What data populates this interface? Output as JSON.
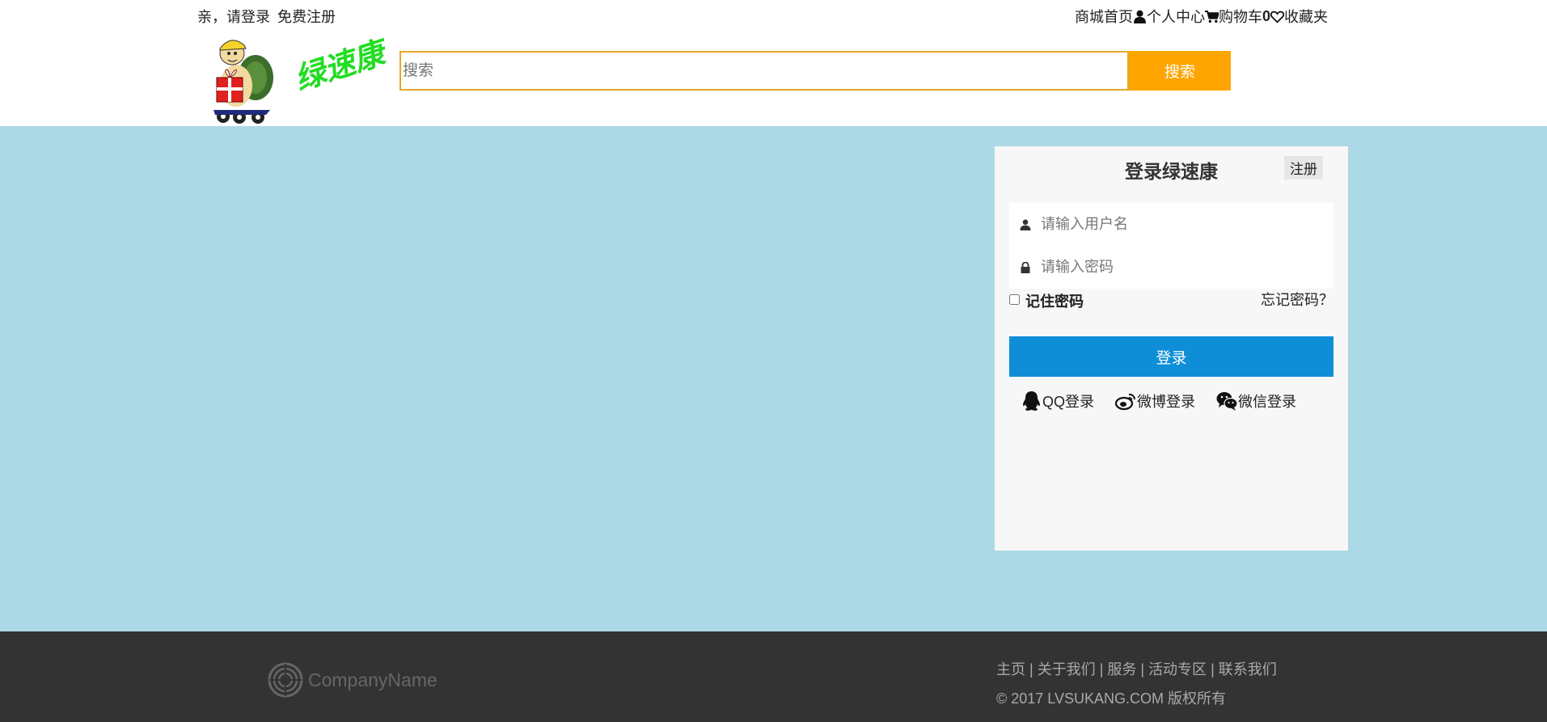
{
  "topbar": {
    "greeting": "亲，请登录",
    "register": "免费注册",
    "home": "商城首页",
    "user_center": "个人中心",
    "cart": "购物车",
    "cart_count": "0",
    "favorites": "收藏夹"
  },
  "header": {
    "logo_text": "绿速康",
    "search_placeholder": "搜索",
    "search_button": "搜索"
  },
  "login": {
    "title": "登录绿速康",
    "register_link": "注册",
    "username_placeholder": "请输入用户名",
    "password_placeholder": "请输入密码",
    "remember": "记住密码",
    "forgot": "忘记密码？",
    "submit": "登录",
    "social": [
      {
        "label": "QQ登录",
        "icon": "qq-icon"
      },
      {
        "label": "微博登录",
        "icon": "weibo-icon"
      },
      {
        "label": "微信登录",
        "icon": "wechat-icon"
      }
    ]
  },
  "footer": {
    "company": "CompanyName",
    "nav": [
      "主页",
      "关于我们",
      "服务",
      "活动专区",
      "联系我们"
    ],
    "copyright": "© 2017 LVSUKANG.COM 版权所有"
  },
  "colors": {
    "main_bg": "#add8e6",
    "search_button": "#ffa500",
    "login_button": "#0e8ed7",
    "footer_bg": "#333333",
    "logo_text": "#22dd22"
  }
}
